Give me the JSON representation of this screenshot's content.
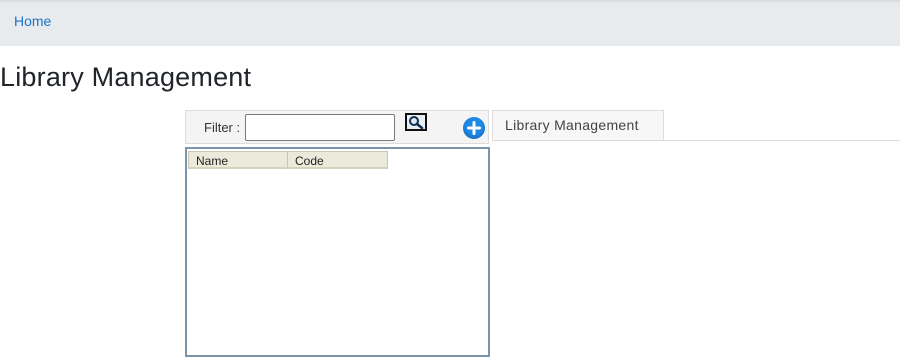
{
  "nav": {
    "home_label": "Home"
  },
  "page": {
    "title": "Library Management"
  },
  "toolbar": {
    "filter_label": "Filter :",
    "filter_value": "",
    "search_icon": "search-icon",
    "add_icon": "plus-icon"
  },
  "tabs": [
    {
      "label": "Library Management"
    }
  ],
  "grid": {
    "columns": [
      "Name",
      "Code"
    ],
    "rows": []
  },
  "colors": {
    "link": "#1a73c9",
    "nav_bg": "#e8ebee",
    "add_button": "#1e88e5",
    "panel_border": "#7a95ab",
    "grid_header_bg": "#ebeadb"
  }
}
